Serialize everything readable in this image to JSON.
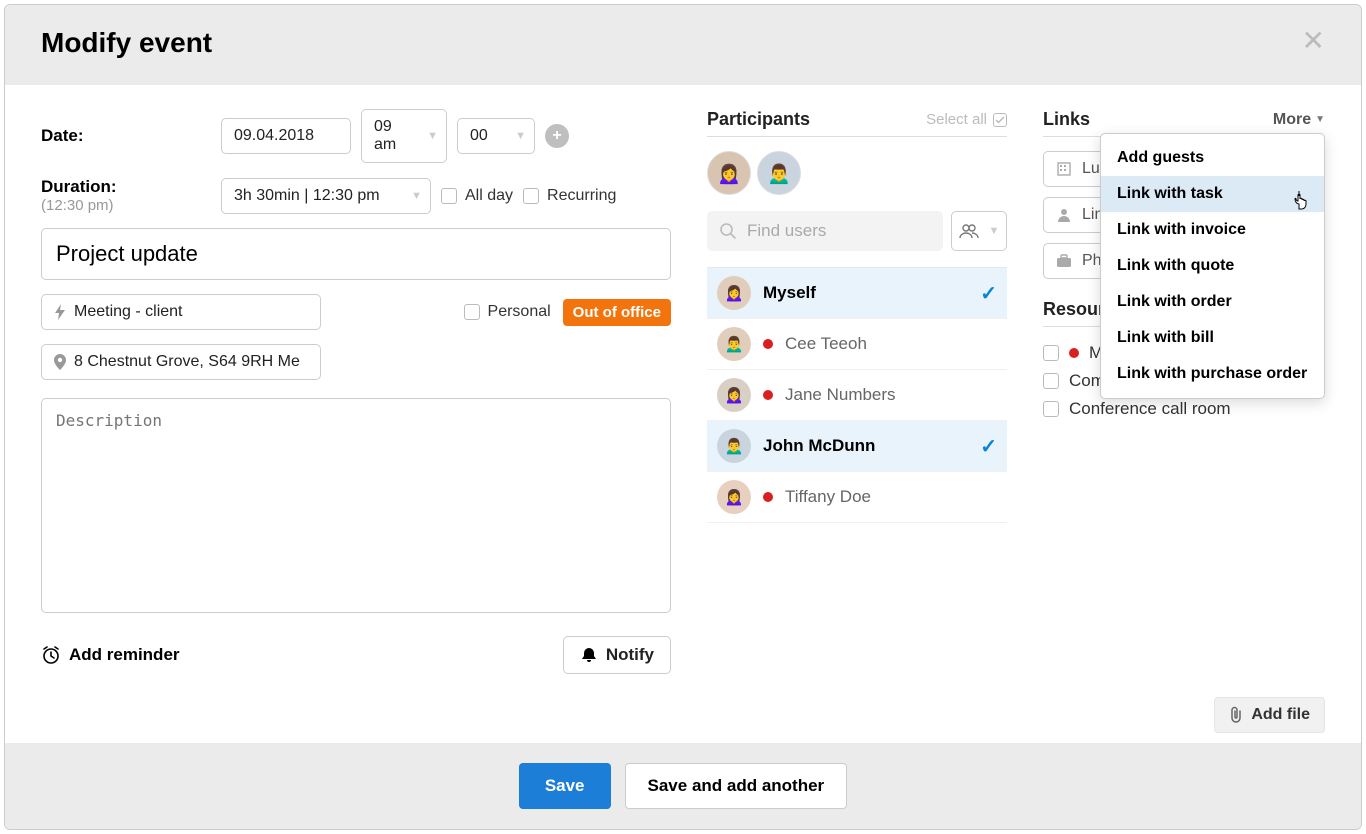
{
  "header": {
    "title": "Modify event"
  },
  "form": {
    "date_label": "Date:",
    "date_value": "09.04.2018",
    "hour_value": "09 am",
    "minute_value": "00",
    "duration_label": "Duration:",
    "duration_sub": "(12:30 pm)",
    "duration_value": "3h 30min  |  12:30 pm",
    "all_day_label": "All day",
    "recurring_label": "Recurring",
    "title_value": "Project update",
    "meeting_type": "Meeting - client",
    "personal_label": "Personal",
    "out_of_office_label": "Out of office",
    "location_value": "8 Chestnut Grove, S64 9RH Me",
    "description_placeholder": "Description",
    "add_reminder_label": "Add reminder",
    "notify_label": "Notify"
  },
  "participants": {
    "title": "Participants",
    "select_all_label": "Select all",
    "find_users_placeholder": "Find users",
    "list": [
      {
        "name": "Myself",
        "selected": true,
        "has_dot": false
      },
      {
        "name": "Cee Teeoh",
        "selected": false,
        "has_dot": true
      },
      {
        "name": "Jane Numbers",
        "selected": false,
        "has_dot": true
      },
      {
        "name": "John McDunn",
        "selected": true,
        "has_dot": false
      },
      {
        "name": "Tiffany Doe",
        "selected": false,
        "has_dot": true
      }
    ]
  },
  "links": {
    "title": "Links",
    "more_label": "More",
    "chips": [
      {
        "icon": "building",
        "text": "Lum"
      },
      {
        "icon": "person",
        "text": "Link"
      },
      {
        "icon": "briefcase",
        "text": "Pha"
      }
    ],
    "dropdown": [
      "Add guests",
      "Link with task",
      "Link with invoice",
      "Link with quote",
      "Link with order",
      "Link with bill",
      "Link with purchase order"
    ],
    "dropdown_hover_index": 1
  },
  "resources": {
    "title": "Resources",
    "items": [
      {
        "name": "M",
        "has_dot": true
      },
      {
        "name": "Company car",
        "has_dot": false
      },
      {
        "name": "Conference call room",
        "has_dot": false
      }
    ]
  },
  "files": {
    "add_file_label": "Add file"
  },
  "footer": {
    "save_label": "Save",
    "save_add_label": "Save and add another"
  }
}
